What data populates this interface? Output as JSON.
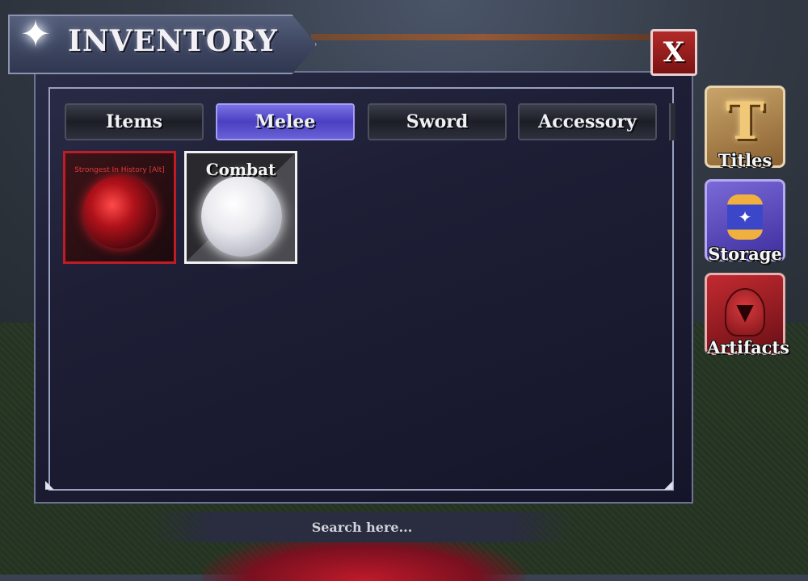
{
  "window": {
    "title": "INVENTORY",
    "close_label": "X"
  },
  "tabs": [
    {
      "label": "Items",
      "active": false
    },
    {
      "label": "Melee",
      "active": true
    },
    {
      "label": "Sword",
      "active": false
    },
    {
      "label": "Accessory",
      "active": false
    }
  ],
  "slots": [
    {
      "label": "Strongest In History [Alt]",
      "rarity_color": "#c01c24",
      "icon": "red-orb-icon"
    },
    {
      "label": "Combat",
      "rarity_color": "#f2f2f2",
      "icon": "white-orb-icon"
    }
  ],
  "sidebar": [
    {
      "label": "Titles",
      "icon": "title-t-icon"
    },
    {
      "label": "Storage",
      "icon": "storage-capsule-icon"
    },
    {
      "label": "Artifacts",
      "icon": "helmet-icon"
    }
  ],
  "search": {
    "placeholder": "Search here..."
  },
  "colors": {
    "active_tab": "#5a50d0",
    "close_button": "#a01e1e"
  }
}
